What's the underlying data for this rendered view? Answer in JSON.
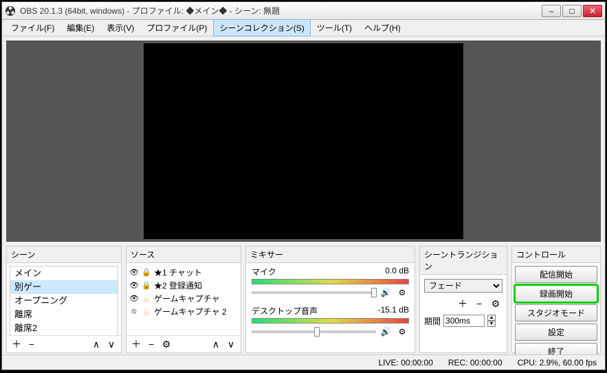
{
  "window": {
    "title": "OBS 20.1.3 (64bit, windows) - プロファイル: ◆メイン◆ - シーン: 無題"
  },
  "menu": {
    "file": "ファイル(F)",
    "edit": "編集(E)",
    "view": "表示(V)",
    "profile": "プロファイル(P)",
    "scene_collection": "シーンコレクション(S)",
    "tools": "ツール(T)",
    "help": "ヘルプ(H)"
  },
  "panels": {
    "scenes_hdr": "シーン",
    "sources_hdr": "ソース",
    "mixer_hdr": "ミキサー",
    "transitions_hdr": "シーントランジション",
    "controls_hdr": "コントロール"
  },
  "scenes": {
    "items": [
      "メイン",
      "別ゲー",
      "オープニング",
      "離席",
      "離席2"
    ]
  },
  "sources": {
    "items": [
      {
        "label": "★1 チャット",
        "locked": true
      },
      {
        "label": "★2 登録通知",
        "locked": true
      },
      {
        "label": "ゲームキャプチャ",
        "locked": false
      },
      {
        "label": "ゲームキャプチャ 2",
        "locked": false,
        "hidden": true
      }
    ]
  },
  "mixer": {
    "mic": {
      "label": "マイク",
      "db": "0.0 dB",
      "thumb_pct": 96
    },
    "desktop": {
      "label": "デスクトップ音声",
      "db": "-15.1 dB",
      "thumb_pct": 50
    }
  },
  "transitions": {
    "selected": "フェード",
    "duration_label": "期間",
    "duration_value": "300ms"
  },
  "controls": {
    "stream": "配信開始",
    "record": "録画開始",
    "studio": "スタジオモード",
    "settings": "設定",
    "exit": "終了"
  },
  "status": {
    "live": "LIVE: 00:00:00",
    "rec": "REC: 00:00:00",
    "cpu": "CPU: 2.9%, 60.00 fps"
  },
  "glyph": {
    "plus": "＋",
    "minus": "−",
    "up": "∧",
    "down": "∨",
    "gear": "⚙",
    "eye": "👁",
    "eye_off": "⦸",
    "lock": "🔒",
    "star": "★",
    "speaker": "🔊",
    "min": "–",
    "max": "□",
    "close": "✕"
  }
}
